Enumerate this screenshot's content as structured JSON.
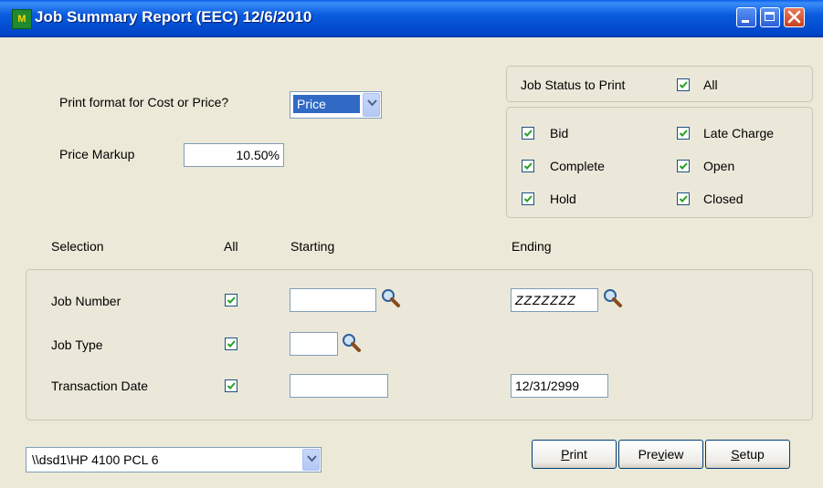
{
  "window": {
    "title": "Job Summary Report (EEC) 12/6/2010",
    "app_icon_text": "M"
  },
  "format": {
    "label": "Print format for Cost or Price?",
    "value": "Price"
  },
  "markup": {
    "label": "Price Markup",
    "value": "10.50%"
  },
  "status": {
    "label": "Job Status to Print",
    "all_label": "All",
    "all_checked": true,
    "items": [
      {
        "label": "Bid",
        "checked": true
      },
      {
        "label": "Late Charge",
        "checked": true
      },
      {
        "label": "Complete",
        "checked": true
      },
      {
        "label": "Open",
        "checked": true
      },
      {
        "label": "Hold",
        "checked": true
      },
      {
        "label": "Closed",
        "checked": true
      }
    ]
  },
  "selection": {
    "headers": {
      "selection": "Selection",
      "all": "All",
      "starting": "Starting",
      "ending": "Ending"
    },
    "rows": [
      {
        "label": "Job Number",
        "all": true,
        "starting": "",
        "ending": "ZZZZZZZ"
      },
      {
        "label": "Job Type",
        "all": true,
        "starting": ""
      },
      {
        "label": "Transaction Date",
        "all": true,
        "starting": "",
        "ending": "12/31/2999"
      }
    ]
  },
  "printer": {
    "value": "\\\\dsd1\\HP 4100 PCL 6"
  },
  "buttons": {
    "print": {
      "pre": "",
      "accel": "P",
      "post": "rint"
    },
    "preview": {
      "pre": "Pre",
      "accel": "v",
      "post": "iew"
    },
    "setup": {
      "pre": "",
      "accel": "S",
      "post": "etup"
    }
  },
  "colors": {
    "title_bar": "#0a5ce0",
    "face": "#ece9d8",
    "check": "#21a121",
    "selection": "#316ac5"
  }
}
